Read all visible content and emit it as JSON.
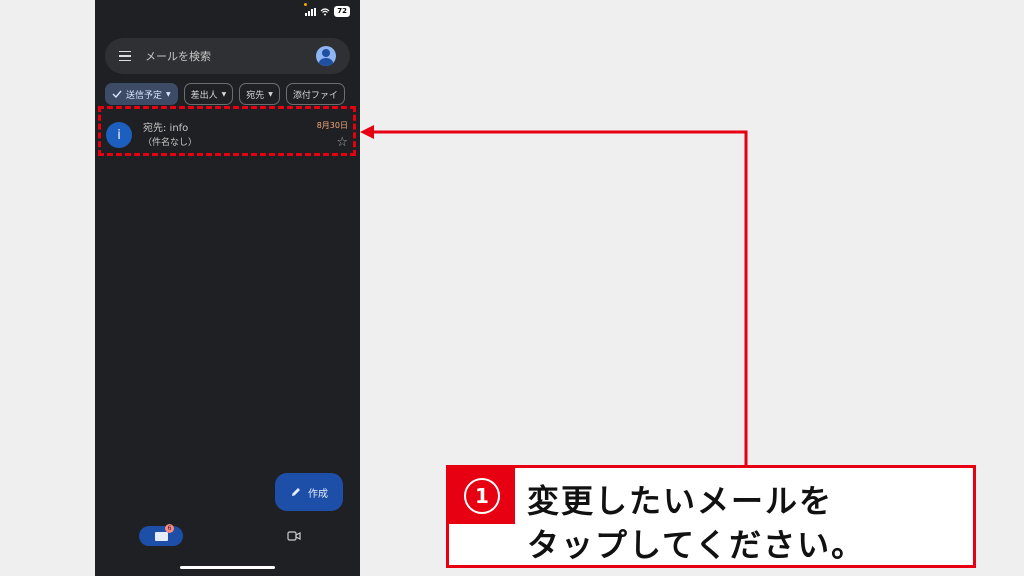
{
  "status": {
    "battery": "72"
  },
  "search": {
    "placeholder": "メールを検索"
  },
  "chips": [
    {
      "label": "送信予定",
      "active": true
    },
    {
      "label": "差出人"
    },
    {
      "label": "宛先"
    },
    {
      "label": "添付ファイ"
    }
  ],
  "mail": {
    "icon_letter": "i",
    "to": "宛先: info",
    "subject": "（件名なし）",
    "date": "8月30日"
  },
  "fab": {
    "label": "作成"
  },
  "nav": {
    "badge": "6"
  },
  "callout": {
    "number": "1",
    "line1": "変更したいメールを",
    "line2": "タップしてください。"
  },
  "colors": {
    "accent": "#e60012",
    "phone_bg": "#1f2024",
    "primary": "#1d4ea8"
  }
}
